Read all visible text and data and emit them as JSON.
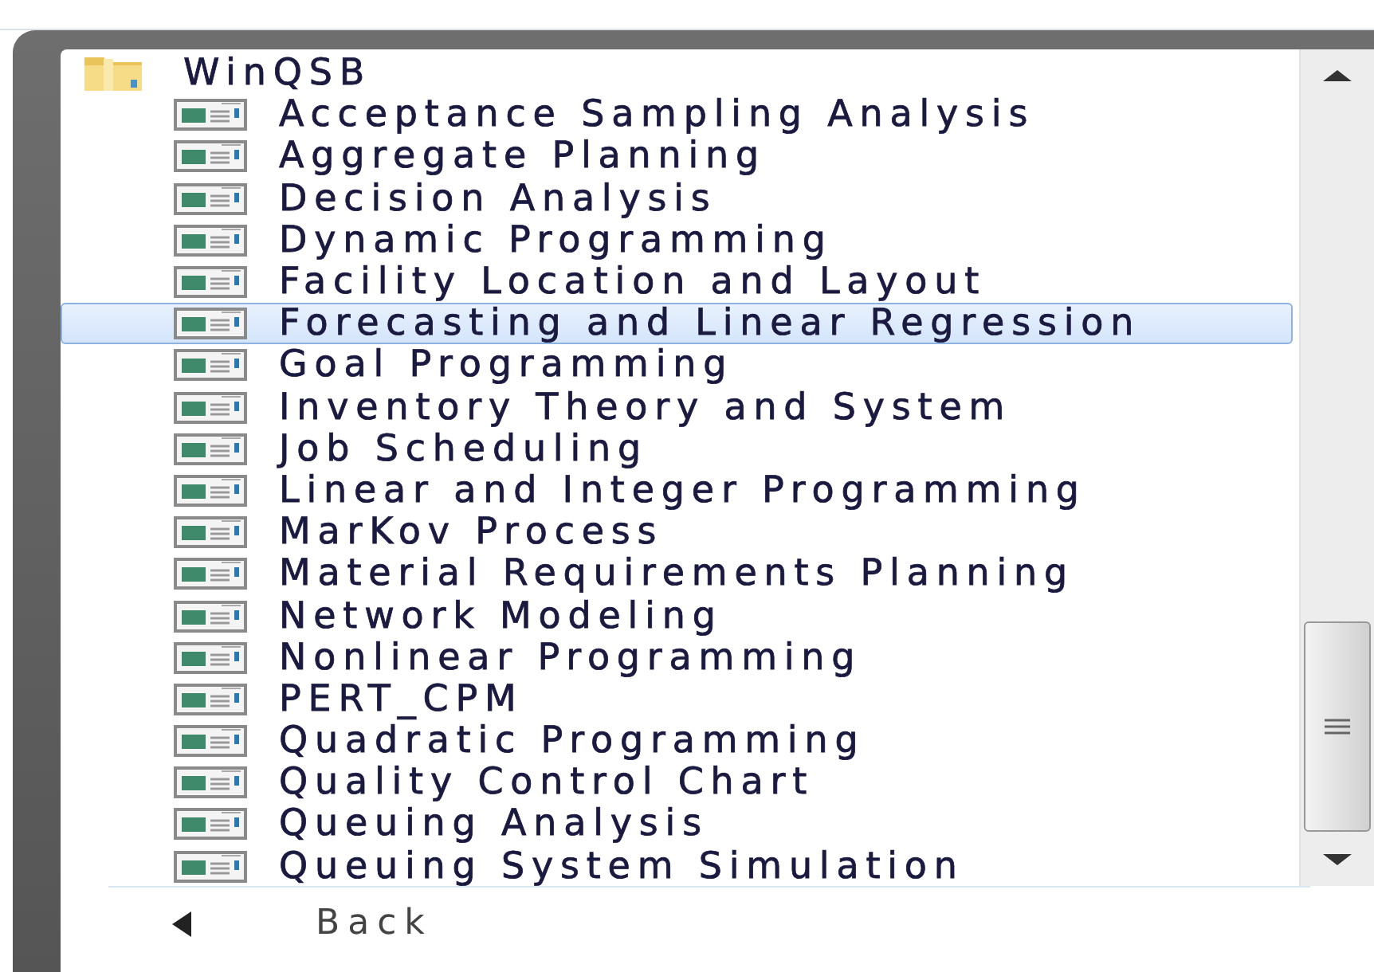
{
  "folder": {
    "label": "WinQSB",
    "children": [
      {
        "label": "Acceptance Sampling Analysis",
        "selected": false
      },
      {
        "label": "Aggregate Planning",
        "selected": false
      },
      {
        "label": "Decision Analysis",
        "selected": false
      },
      {
        "label": "Dynamic Programming",
        "selected": false
      },
      {
        "label": "Facility Location and Layout",
        "selected": false
      },
      {
        "label": "Forecasting and Linear Regression",
        "selected": true
      },
      {
        "label": "Goal Programming",
        "selected": false
      },
      {
        "label": "Inventory Theory and System",
        "selected": false
      },
      {
        "label": "Job Scheduling",
        "selected": false
      },
      {
        "label": "Linear and Integer Programming",
        "selected": false
      },
      {
        "label": "MarKov Process",
        "selected": false
      },
      {
        "label": "Material Requirements Planning",
        "selected": false
      },
      {
        "label": "Network Modeling",
        "selected": false
      },
      {
        "label": "Nonlinear Programming",
        "selected": false
      },
      {
        "label": "PERT_CPM",
        "selected": false
      },
      {
        "label": "Quadratic Programming",
        "selected": false
      },
      {
        "label": "Quality Control Chart",
        "selected": false
      },
      {
        "label": "Queuing Analysis",
        "selected": false
      },
      {
        "label": "Queuing System Simulation",
        "selected": false
      }
    ]
  },
  "back": {
    "label": "Back"
  }
}
